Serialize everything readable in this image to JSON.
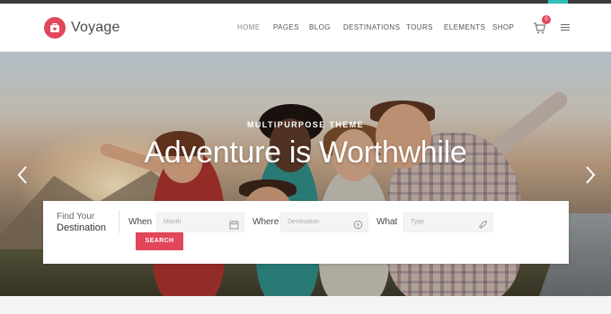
{
  "brand": {
    "name": "Voyage",
    "accent": "#e2465a"
  },
  "nav": {
    "items": [
      {
        "label": "HOME",
        "active": true
      },
      {
        "label": "PAGES",
        "active": false
      },
      {
        "label": "BLOG",
        "active": false
      },
      {
        "label": "DESTINATIONS",
        "active": false
      },
      {
        "label": "TOURS",
        "active": false
      },
      {
        "label": "ELEMENTS",
        "active": false
      },
      {
        "label": "SHOP",
        "active": false
      }
    ],
    "cart_count": "0",
    "cart_icon": "shopping-cart-icon",
    "menu_icon": "hamburger-menu-icon"
  },
  "hero": {
    "eyebrow": "MULTIPURPOSE THEME",
    "headline": "Adventure is Worthwhile",
    "prev_icon": "chevron-left-icon",
    "next_icon": "chevron-right-icon"
  },
  "search": {
    "title_line1": "Find Your",
    "title_line2": "Destination",
    "when_label": "When",
    "when_placeholder": "Month",
    "when_icon": "calendar-icon",
    "where_label": "Where",
    "where_placeholder": "Destination",
    "where_icon": "compass-icon",
    "what_label": "What",
    "what_placeholder": "Type",
    "what_icon": "rocket-icon",
    "button_label": "SEARCH"
  }
}
